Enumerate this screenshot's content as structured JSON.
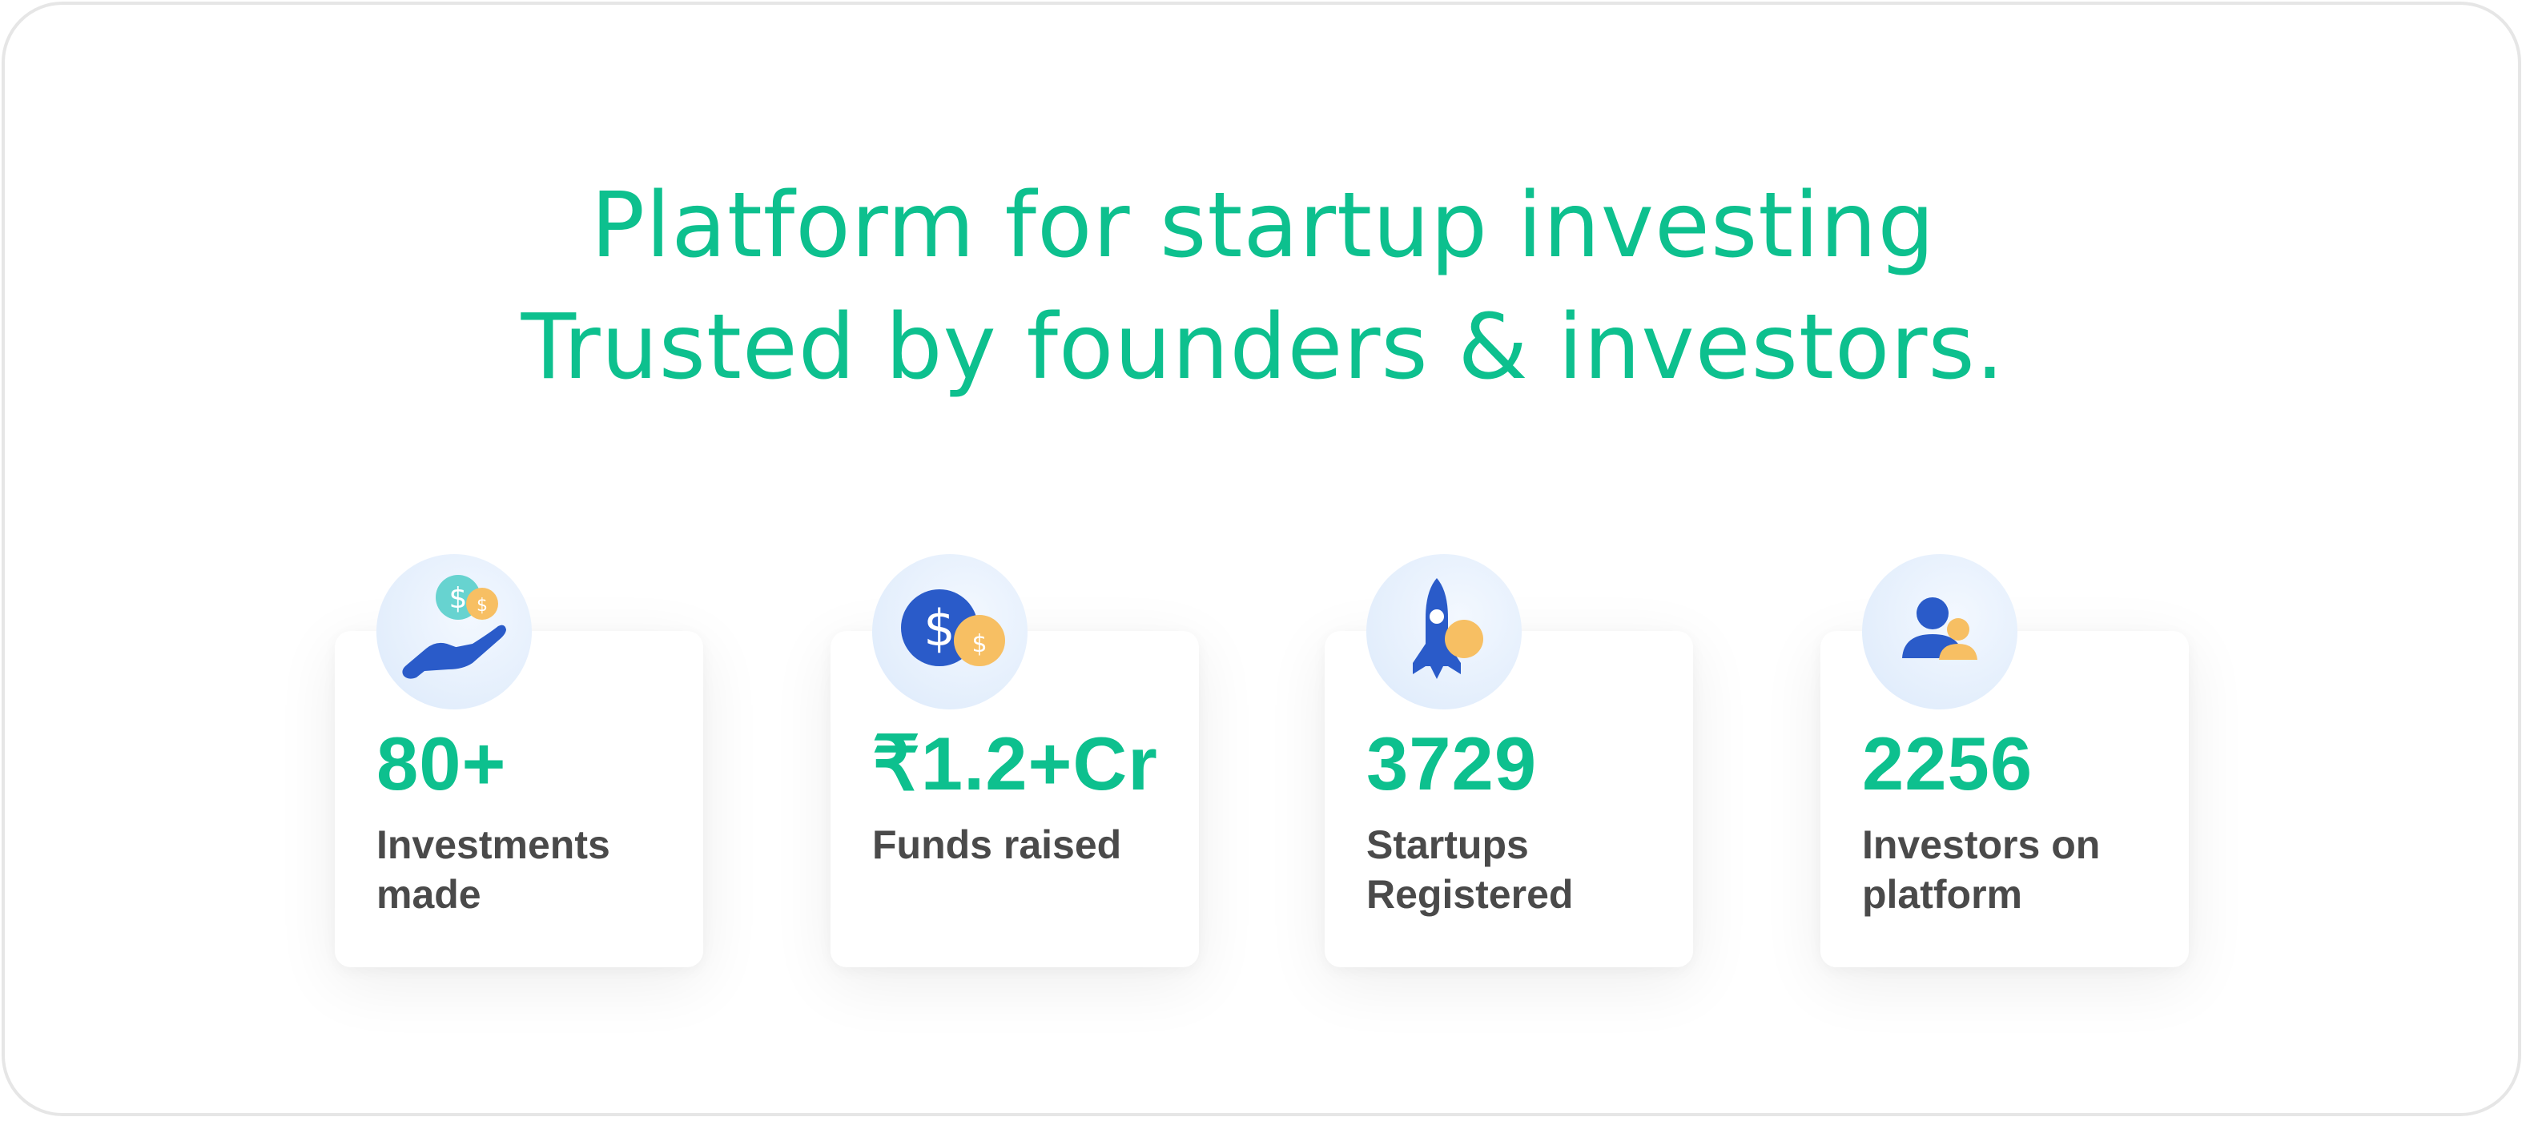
{
  "headline": {
    "line1": "Platform for startup investing",
    "line2": "Trusted by founders & investors."
  },
  "colors": {
    "accent": "#0dc08e",
    "label": "#4a4a4a",
    "icon_blue": "#2a5bc9",
    "icon_coin": "#f7bf63",
    "icon_teal": "#67d3d0",
    "icon_bg": "#e3eefc",
    "frame_border": "#e6e6e6"
  },
  "stats": [
    {
      "icon": "hand-coins-icon",
      "value": "80+",
      "label": "Investments made"
    },
    {
      "icon": "dollar-coins-icon",
      "value": "₹1.2+Cr",
      "label": "Funds raised"
    },
    {
      "icon": "rocket-icon",
      "value": "3729",
      "label": "Startups Registered"
    },
    {
      "icon": "investors-icon",
      "value": "2256",
      "label": "Investors on platform"
    }
  ]
}
